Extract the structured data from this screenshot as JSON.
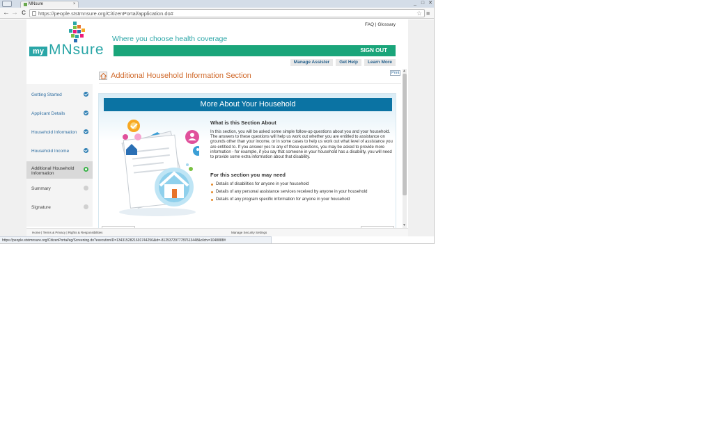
{
  "browser": {
    "tab_title": "MNsure",
    "tab_close": "×",
    "url": "https://people.ststmnsure.org/CitizenPortal/application.do#",
    "nav_back": "←",
    "nav_forward": "→",
    "nav_reload": "C",
    "star": "☆",
    "menu": "≡",
    "window_buttons": [
      "_",
      "□",
      "✕"
    ],
    "status_url": "https://people.ststmnsure.org/CitizenPortal/eg/Screening.do?executionID=1343152821691744256&id=-8125372977787613448&cilctv=1048888#"
  },
  "header": {
    "top_links": [
      "FAQ",
      "Glossary"
    ],
    "top_links_sep": " | ",
    "logo_my": "my",
    "logo_mn": "MNsure",
    "tagline": "Where you choose health coverage",
    "sign_out": "SIGN OUT",
    "subnav": [
      "Manage Assister",
      "Get Help",
      "Learn More"
    ]
  },
  "sidebar": {
    "items": [
      {
        "label": "Getting Started",
        "status": "complete"
      },
      {
        "label": "Applicant Details",
        "status": "complete"
      },
      {
        "label": "Household Information",
        "status": "complete"
      },
      {
        "label": "Household Income",
        "status": "complete"
      },
      {
        "label": "Additional Household Information",
        "status": "current"
      },
      {
        "label": "Summary",
        "status": "pending"
      },
      {
        "label": "Signature",
        "status": "pending"
      }
    ]
  },
  "main": {
    "section_title": "Additional Household Information Section",
    "print_label": "Print",
    "card_header": "More About Your Household",
    "what_heading": "What is this Section About",
    "what_body": "In this section, you will be asked some simple follow-up questions about you and your household. The answers to these questions will help us work out whether you are entitled to assistance on grounds other than your income, or in some cases to help us work out what level of assistance you are entitled to. If you answer yes to any of these questions, you may be asked to provide more information - for example, if you say that someone in your household has a disability, you will need to provide some extra information about that disability.",
    "need_heading": "For this section you may need",
    "need_items": [
      "Details of disabilities for anyone in your household",
      "Details of any personal assistance services received by anyone in your household",
      "Details of any program specific information for anyone in your household"
    ]
  },
  "footer": {
    "links": [
      "Home",
      "Terms & Privacy",
      "Rights & Responsibilities"
    ],
    "links_sep": " | ",
    "center": "Manage Security Settings"
  },
  "colors": {
    "brand_teal": "#2aa6a7",
    "sign_out_green": "#1aa57a",
    "header_blue": "#0b73a3",
    "title_orange": "#d06a2c",
    "check_blue": "#2f7fb3",
    "current_green": "#3cb24a"
  }
}
